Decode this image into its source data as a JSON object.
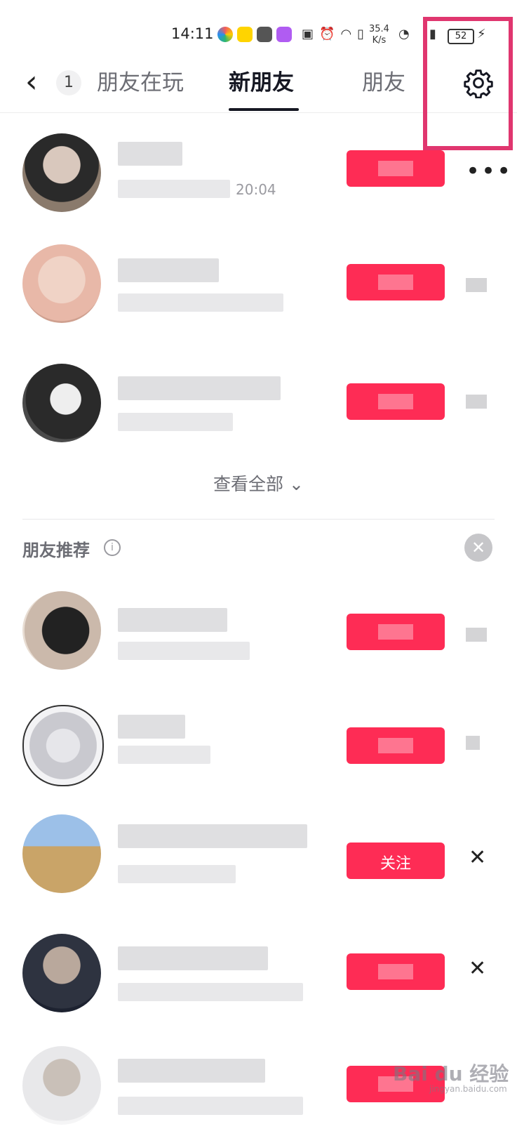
{
  "status_bar": {
    "time": "14:11",
    "net_speed_value": "35.4",
    "net_speed_unit": "K/s",
    "battery": "52"
  },
  "nav": {
    "back_glyph": "‹",
    "badge_count": "1",
    "tabs": [
      {
        "label": "朋友在玩",
        "active": false
      },
      {
        "label": "新朋友",
        "active": true
      },
      {
        "label": "朋友",
        "active": false
      }
    ],
    "settings_icon": "gear-icon"
  },
  "new_friends": {
    "rows": [
      {
        "time": "20:04"
      },
      {
        "time": ""
      },
      {
        "time": ""
      }
    ],
    "see_all_label": "查看全部"
  },
  "recommend": {
    "title": "朋友推荐",
    "visible_follow_label": "关注"
  },
  "watermark": {
    "text": "Bai du 经验",
    "sub": "jingyan.baidu.com"
  },
  "colors": {
    "accent": "#fe2c55",
    "highlight_frame": "#e0366f"
  }
}
